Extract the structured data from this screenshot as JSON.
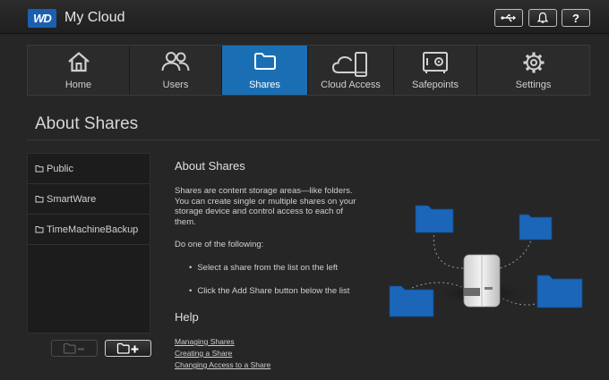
{
  "header": {
    "logo_text": "WD",
    "app_title": "My Cloud",
    "help_glyph": "?",
    "icons": [
      "usb-icon",
      "bell-icon",
      "help-icon"
    ]
  },
  "nav": {
    "tabs": [
      {
        "label": "Home",
        "icon": "home-icon",
        "active": false
      },
      {
        "label": "Users",
        "icon": "users-icon",
        "active": false
      },
      {
        "label": "Shares",
        "icon": "folder-icon",
        "active": true
      },
      {
        "label": "Cloud Access",
        "icon": "cloud-device-icon",
        "active": false
      },
      {
        "label": "Safepoints",
        "icon": "safe-icon",
        "active": false
      },
      {
        "label": "Settings",
        "icon": "gear-icon",
        "active": false
      }
    ]
  },
  "page": {
    "title": "About Shares"
  },
  "shares": {
    "items": [
      "Public",
      "SmartWare",
      "TimeMachineBackup"
    ]
  },
  "content": {
    "title": "About Shares",
    "description": "Shares are content storage areas—like folders. You can create single or multiple shares on your storage device and control access to each of them.",
    "instruction": "Do one of the following:",
    "bullets": [
      "Select a share from the list on the left",
      "Click the Add Share button below the list"
    ]
  },
  "help": {
    "title": "Help",
    "links": [
      "Managing Shares",
      "Creating a Share",
      "Changing Access to a Share"
    ]
  },
  "colors": {
    "accent": "#1a6fb4",
    "folder": "#1b66b8",
    "background": "#262626"
  }
}
